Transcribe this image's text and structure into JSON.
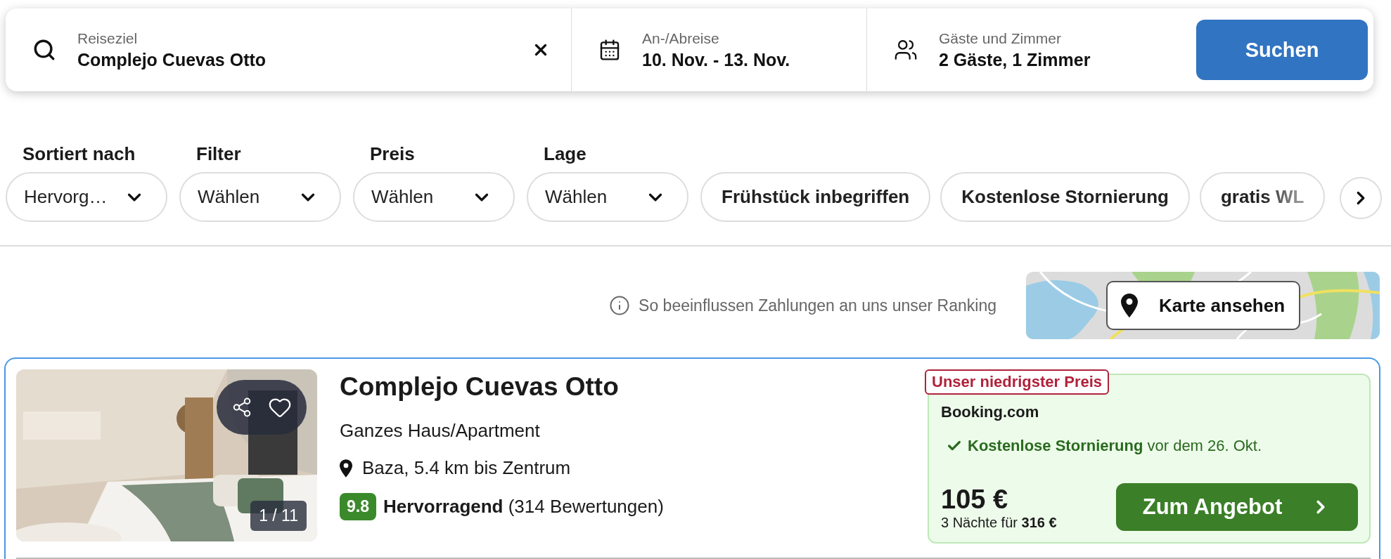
{
  "search": {
    "destination": {
      "label": "Reiseziel",
      "value": "Complejo Cuevas Otto"
    },
    "dates": {
      "label": "An-/Abreise",
      "value": "10. Nov. - 13. Nov."
    },
    "guests": {
      "label": "Gäste und Zimmer",
      "value": "2 Gäste, 1 Zimmer"
    },
    "button": "Suchen"
  },
  "filters": [
    {
      "label": "Sortiert nach",
      "value": "Hervorg…"
    },
    {
      "label": "Filter",
      "value": "Wählen"
    },
    {
      "label": "Preis",
      "value": "Wählen"
    },
    {
      "label": "Lage",
      "value": "Wählen"
    }
  ],
  "chips": [
    {
      "label": "Frühstück inbegriffen",
      "faded": false
    },
    {
      "label": "Kostenlose Stornierung",
      "faded": false
    },
    {
      "label": "gratis WL",
      "faded": true
    }
  ],
  "ranking_note": "So beeinflussen Zahlungen an uns unser Ranking",
  "map_button": "Karte ansehen",
  "listing": {
    "image_counter": "1 / 11",
    "title": "Complejo Cuevas Otto",
    "type": "Ganzes Haus/Apartment",
    "location": "Baza, 5.4 km bis Zentrum",
    "rating": {
      "score": "9.8",
      "text": "**Hervorragend** (314 Bewertungen)"
    },
    "offer": {
      "tag": "Unser niedrigster Preis",
      "provider": "Booking.com",
      "cancellation": "**Kostenlose Stornierung** vor dem 26. Okt.",
      "price": "105 €",
      "total": "3 Nächte für **316 €**",
      "button": "Zum Angebot"
    }
  }
}
